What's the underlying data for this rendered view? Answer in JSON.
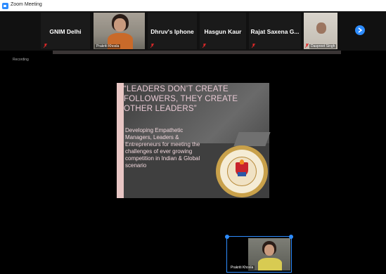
{
  "window": {
    "title": "Zoom Meeting"
  },
  "strip": {
    "tiles": [
      {
        "name": "GNIM Delhi"
      },
      {
        "name": "Prakriti Khosla",
        "video": true
      },
      {
        "name": "Dhruv's Iphone"
      },
      {
        "name": "Hasgun Kaur"
      },
      {
        "name": "Rajat Saxena G..."
      },
      {
        "name": "Daspreet Singh",
        "video": true
      }
    ],
    "next_icon": "chevron-right-icon"
  },
  "top_left_label": "Recording",
  "slide": {
    "quote": "“LEADERS DON’T CREATE FOLLOWERS, THEY CREATE OTHER LEADERS”",
    "subtitle": "Developing Empathetic Managers, Leaders & Entrepreneurs for meeting the challenges of ever growing competition in Indian & Global scenario",
    "seal_icon": "institute-seal-icon"
  },
  "pip": {
    "name": "Prakriti Khosla"
  },
  "colors": {
    "accent": "#2d8cff",
    "muted": "#e02828",
    "quote": "#e8c9d4"
  }
}
